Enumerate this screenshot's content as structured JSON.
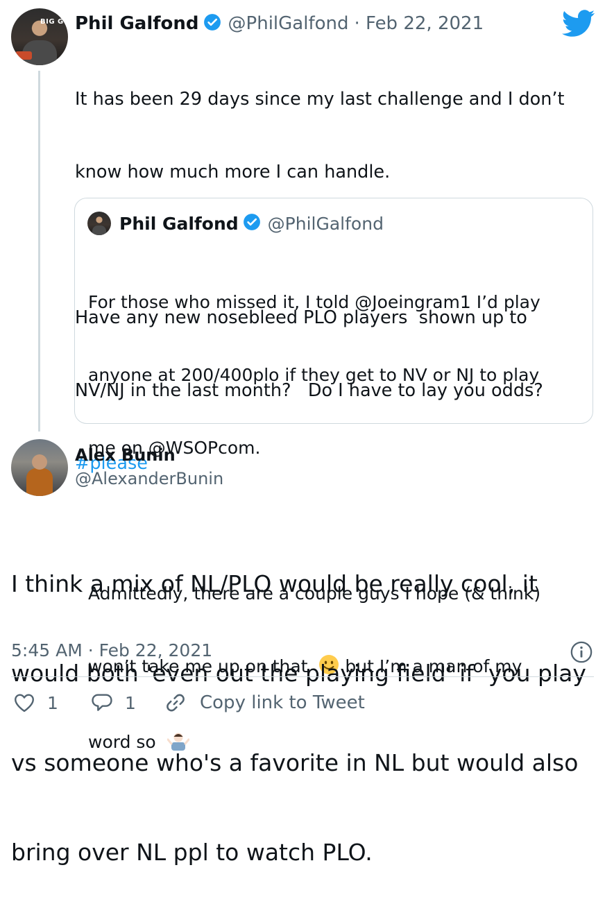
{
  "parent_tweet": {
    "author_name": "Phil Galfond",
    "author_handle": "@PhilGalfond",
    "date": "· Feb 22, 2021",
    "avatar_text": "BIG G",
    "text_lines": [
      "It has been 29 days since my last challenge and I don’t",
      "know how much more I can handle.",
      "",
      "Have any new nosebleed PLO players  shown up to",
      "NV/NJ in the last month?   Do I have to lay you odds?"
    ],
    "hashtag": "#please"
  },
  "quoted_tweet": {
    "author_name": "Phil Galfond",
    "author_handle": "@PhilGalfond",
    "line1": "For those who missed it, I told @Joeingram1 I’d play",
    "line2": "anyone at 200/400plo if they get to NV or NJ to play",
    "line3": "me on @WSOPcom.",
    "line4": "Admittedly, there are a couple guys I hope (& think)",
    "line5a": "won’t take me up on that",
    "line5b": " but I’m a man of my",
    "line6": "word so"
  },
  "reply_tweet": {
    "author_name": "Alex Bunin",
    "author_handle": "@AlexanderBunin",
    "text_lines": [
      "I think a mix of NL/PLO would be really cool, it",
      "would both 'even out the playing field' if  you play",
      "vs someone who's a favorite in NL but would also",
      "bring over NL ppl to watch PLO."
    ],
    "timestamp": "5:45 AM · Feb 22, 2021"
  },
  "actions": {
    "like_count": "1",
    "reply_count": "1",
    "copy_link_label": "Copy link to Tweet"
  },
  "colors": {
    "accent": "#1d9bf0",
    "text": "#0f1419",
    "secondary": "#536471",
    "border": "#cfd9de"
  },
  "icons": [
    "twitter-bird-icon",
    "verified-badge-icon",
    "info-icon",
    "heart-icon",
    "reply-icon",
    "link-icon",
    "smiley-emoji",
    "shrug-emoji"
  ]
}
